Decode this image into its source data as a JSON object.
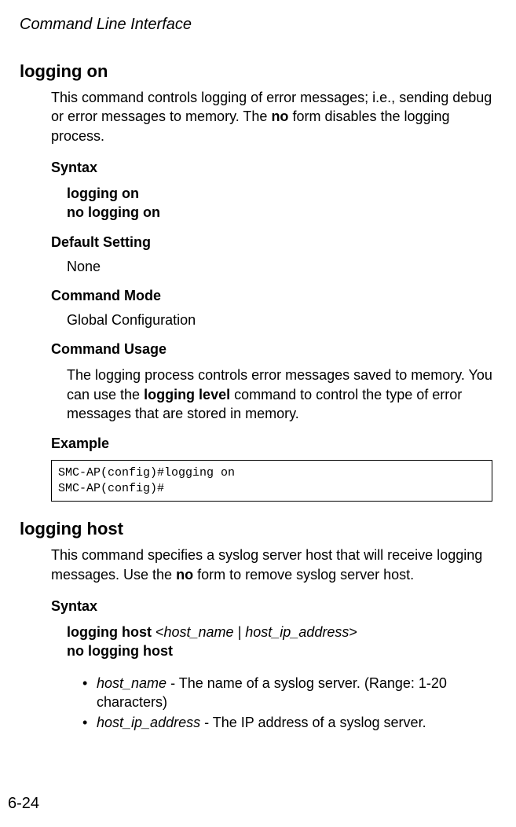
{
  "header": "Command Line Interface",
  "section1": {
    "title": "logging on",
    "description_parts": {
      "p1": "This command controls logging of error messages; i.e., sending debug or error messages to memory. The ",
      "bold": "no",
      "p2": " form disables the logging process."
    },
    "syntax_heading": "Syntax",
    "syntax_lines": {
      "l1": "logging on",
      "l2": "no logging on"
    },
    "default_heading": "Default Setting",
    "default_value": "None",
    "mode_heading": "Command Mode",
    "mode_value": "Global Configuration",
    "usage_heading": "Command Usage",
    "usage_parts": {
      "p1": "The logging process controls error messages saved to memory. You can use the ",
      "bold": "logging level",
      "p2": " command to control the type of error messages that are stored in memory."
    },
    "example_heading": "Example",
    "example_code": "SMC-AP(config)#logging on\nSMC-AP(config)#"
  },
  "section2": {
    "title": "logging host",
    "description_parts": {
      "p1": "This command specifies a syslog server host that will receive logging messages. Use the ",
      "bold": "no",
      "p2": " form to remove syslog server host."
    },
    "syntax_heading": "Syntax",
    "syntax_line1": {
      "bold1": "logging host ",
      "angle1": "<",
      "italic": "host_name | host_ip_address",
      "angle2": ">"
    },
    "syntax_line2": "no logging host",
    "bullets": {
      "b1_italic": "host_name",
      "b1_text": " - The name of a syslog server. (Range: 1-20 characters)",
      "b2_italic": "host_ip_address",
      "b2_text": " - The IP address of a syslog server."
    }
  },
  "page_number": "6-24"
}
